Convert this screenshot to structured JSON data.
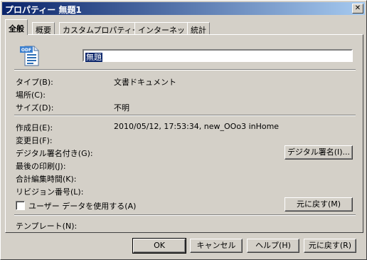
{
  "window": {
    "title": "プロパティー 無題1",
    "close_glyph": "✕"
  },
  "tabs": [
    "全般",
    "概要",
    "カスタムプロパティー",
    "インターネット",
    "統計"
  ],
  "general": {
    "doc_icon_label": "ODF",
    "name": "無題",
    "type_label": "タイプ(B):",
    "type_value": "文書ドキュメント",
    "location_label": "場所(C):",
    "size_label": "サイズ(D):",
    "size_value": "不明",
    "created_label": "作成日(E):",
    "created_value": "2010/05/12, 17:53:34, new_OOo3 inHome",
    "modified_label": "変更日(F):",
    "signed_label": "デジタル署名付き(G):",
    "printed_label": "最後の印刷(J):",
    "editing_time_label": "合計編集時間(K):",
    "revision_label": "リビジョン番号(L):",
    "user_data_label": "ユーザー データを使用する(A)",
    "template_label": "テンプレート(N):",
    "digital_signature_button": "デジタル署名(I)...",
    "reset_button": "元に戻す(M)"
  },
  "footer": {
    "ok": "OK",
    "cancel": "キャンセル",
    "help": "ヘルプ(H)",
    "reset": "元に戻す(R)"
  }
}
